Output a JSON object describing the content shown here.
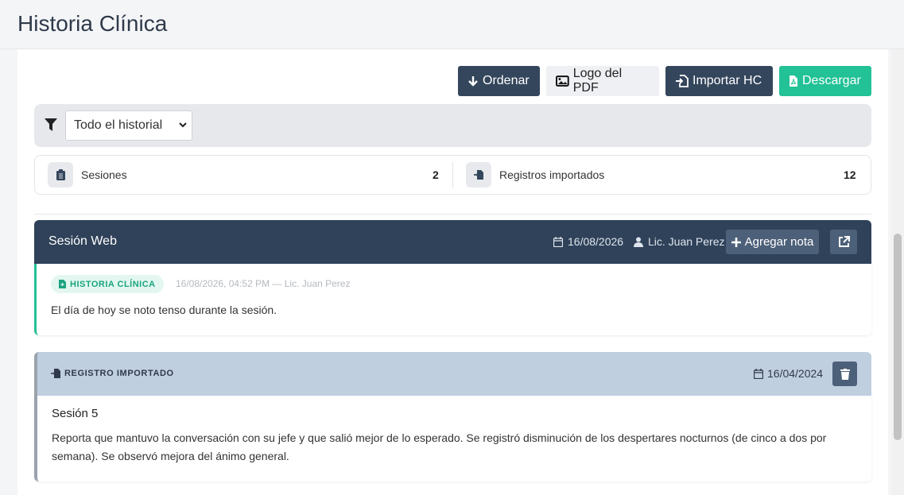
{
  "page": {
    "title": "Historia Clínica"
  },
  "toolbar": {
    "ordenar_label": "Ordenar",
    "logo_pdf_label": "Logo del PDF",
    "importar_label": "Importar HC",
    "descargar_label": "Descargar"
  },
  "filter": {
    "selected": "Todo el historial"
  },
  "stats": {
    "sesiones_label": "Sesiones",
    "sesiones_value": "2",
    "importados_label": "Registros importados",
    "importados_value": "12"
  },
  "session": {
    "title": "Sesión Web",
    "date": "16/08/2026",
    "professional": "Lic. Juan Perez",
    "add_note_label": "Agregar nota",
    "note": {
      "tag": "HISTORIA CLÍNICA",
      "meta": "16/08/2026, 04:52 PM — Lic. Juan Perez",
      "text": "El día de hoy se noto tenso durante la sesión."
    }
  },
  "imported": {
    "label": "REGISTRO IMPORTADO",
    "date": "16/04/2024",
    "title": "Sesión 5",
    "text": "Reporta que mantuvo la conversación con su jefe y que salió mejor de lo esperado. Se registró disminución de los despertares nocturnos (de cinco a dos por semana). Se observó mejora del ánimo general."
  },
  "colors": {
    "primary_dark": "#34465c",
    "accent_green": "#22c196",
    "imported_header": "#c0cfe0"
  },
  "icons": [
    "arrow-down-icon",
    "image-icon",
    "file-import-icon",
    "file-pdf-icon",
    "filter-icon",
    "clipboard-icon",
    "calendar-icon",
    "user-icon",
    "plus-icon",
    "external-link-icon",
    "trash-icon"
  ]
}
